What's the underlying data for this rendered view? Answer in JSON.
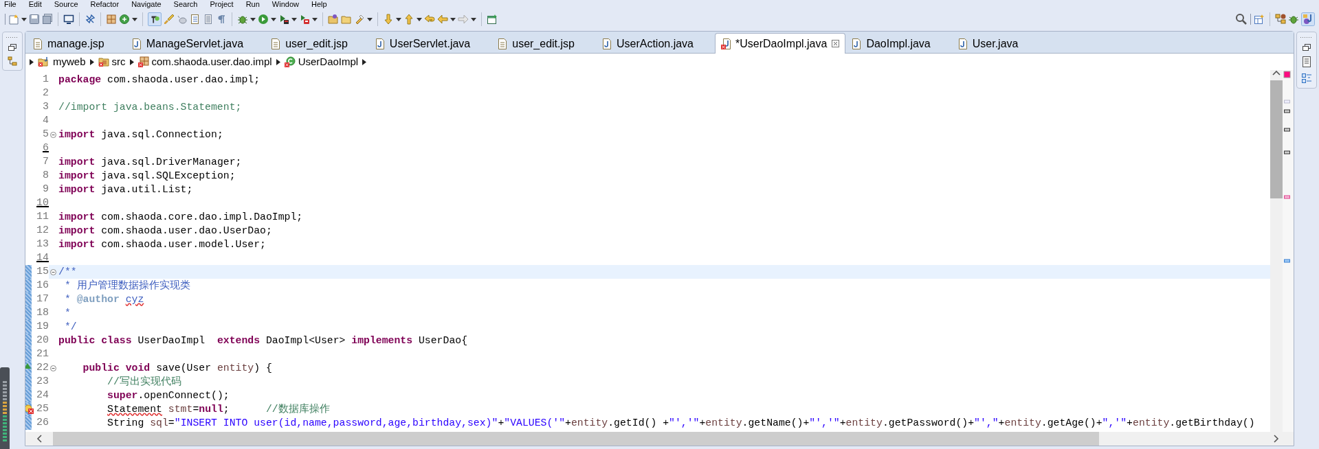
{
  "menu": [
    "File",
    "Edit",
    "Source",
    "Refactor",
    "Navigate",
    "Search",
    "Project",
    "Run",
    "Window",
    "Help"
  ],
  "tabs": [
    {
      "label": "manage.jsp",
      "kind": "jsp",
      "selected": false
    },
    {
      "label": "ManageServlet.java",
      "kind": "java",
      "selected": false
    },
    {
      "label": "user_edit.jsp",
      "kind": "jsp",
      "selected": false
    },
    {
      "label": "UserServlet.java",
      "kind": "java",
      "selected": false
    },
    {
      "label": "user_edit.jsp",
      "kind": "jsp",
      "selected": false
    },
    {
      "label": "UserAction.java",
      "kind": "java",
      "selected": false
    },
    {
      "label": "*UserDaoImpl.java",
      "kind": "java-error",
      "selected": true
    },
    {
      "label": "DaoImpl.java",
      "kind": "java",
      "selected": false
    },
    {
      "label": "User.java",
      "kind": "java",
      "selected": false
    }
  ],
  "breadcrumb": [
    {
      "label": "myweb",
      "kind": "project"
    },
    {
      "label": "src",
      "kind": "folder"
    },
    {
      "label": "com.shaoda.user.dao.impl",
      "kind": "package"
    },
    {
      "label": "UserDaoImpl",
      "kind": "class"
    }
  ],
  "editor": {
    "lines": [
      {
        "number": "1",
        "fold": false,
        "current": false,
        "changed": false,
        "deleted": false,
        "override_marker": false,
        "error_marker": false,
        "tokens": [
          {
            "kind": "keyword",
            "text": "package"
          },
          {
            "kind": "plain",
            "text": " com.shaoda.user.dao.impl;"
          }
        ]
      },
      {
        "number": "2",
        "fold": false,
        "current": false,
        "changed": false,
        "deleted": false,
        "override_marker": false,
        "error_marker": false
      },
      {
        "number": "3",
        "fold": false,
        "current": false,
        "changed": false,
        "deleted": false,
        "override_marker": false,
        "error_marker": false,
        "tokens": [
          {
            "kind": "comment",
            "text": "//import java.beans.Statement;"
          }
        ]
      },
      {
        "number": "4",
        "fold": false,
        "current": false,
        "changed": false,
        "deleted": false,
        "override_marker": false,
        "error_marker": false
      },
      {
        "number": "5",
        "fold": true,
        "current": false,
        "changed": false,
        "deleted": false,
        "override_marker": false,
        "error_marker": false,
        "tokens": [
          {
            "kind": "keyword",
            "text": "import"
          },
          {
            "kind": "plain",
            "text": " java.sql.Connection;"
          }
        ]
      },
      {
        "number": "6",
        "fold": false,
        "current": false,
        "changed": false,
        "deleted": true,
        "override_marker": false,
        "error_marker": false
      },
      {
        "number": "7",
        "fold": false,
        "current": false,
        "changed": false,
        "deleted": false,
        "override_marker": false,
        "error_marker": false,
        "tokens": [
          {
            "kind": "keyword",
            "text": "import"
          },
          {
            "kind": "plain",
            "text": " java.sql.DriverManager;"
          }
        ]
      },
      {
        "number": "8",
        "fold": false,
        "current": false,
        "changed": false,
        "deleted": false,
        "override_marker": false,
        "error_marker": false,
        "tokens": [
          {
            "kind": "keyword",
            "text": "import"
          },
          {
            "kind": "plain",
            "text": " java.sql.SQLException;"
          }
        ]
      },
      {
        "number": "9",
        "fold": false,
        "current": false,
        "changed": false,
        "deleted": false,
        "override_marker": false,
        "error_marker": false,
        "tokens": [
          {
            "kind": "keyword",
            "text": "import"
          },
          {
            "kind": "plain",
            "text": " java.util.List;"
          }
        ]
      },
      {
        "number": "10",
        "fold": false,
        "current": false,
        "changed": false,
        "deleted": true,
        "override_marker": false,
        "error_marker": false
      },
      {
        "number": "11",
        "fold": false,
        "current": false,
        "changed": false,
        "deleted": false,
        "override_marker": false,
        "error_marker": false,
        "tokens": [
          {
            "kind": "keyword",
            "text": "import"
          },
          {
            "kind": "plain",
            "text": " com.shaoda.core.dao.impl.DaoImpl;"
          }
        ]
      },
      {
        "number": "12",
        "fold": false,
        "current": false,
        "changed": false,
        "deleted": false,
        "override_marker": false,
        "error_marker": false,
        "tokens": [
          {
            "kind": "keyword",
            "text": "import"
          },
          {
            "kind": "plain",
            "text": " com.shaoda.user.dao.UserDao;"
          }
        ]
      },
      {
        "number": "13",
        "fold": false,
        "current": false,
        "changed": false,
        "deleted": false,
        "override_marker": false,
        "error_marker": false,
        "tokens": [
          {
            "kind": "keyword",
            "text": "import"
          },
          {
            "kind": "plain",
            "text": " com.shaoda.user.model.User;"
          }
        ]
      },
      {
        "number": "14",
        "fold": false,
        "current": false,
        "changed": false,
        "deleted": true,
        "override_marker": false,
        "error_marker": false
      },
      {
        "number": "15",
        "fold": true,
        "current": true,
        "changed": true,
        "deleted": false,
        "override_marker": false,
        "error_marker": false,
        "tokens": [
          {
            "kind": "javadoc",
            "text": "/**"
          }
        ]
      },
      {
        "number": "16",
        "fold": false,
        "current": false,
        "changed": true,
        "deleted": false,
        "override_marker": false,
        "error_marker": false,
        "tokens": [
          {
            "kind": "javadoc",
            "text": " * 用户管理数据操作实现类"
          }
        ]
      },
      {
        "number": "17",
        "fold": false,
        "current": false,
        "changed": true,
        "deleted": false,
        "override_marker": false,
        "error_marker": false,
        "tokens": [
          {
            "kind": "javadoc",
            "text": " * "
          },
          {
            "kind": "javadoc-tag",
            "text": "@author"
          },
          {
            "kind": "javadoc-misspelled",
            "text": " cyz"
          }
        ]
      },
      {
        "number": "18",
        "fold": false,
        "current": false,
        "changed": true,
        "deleted": false,
        "override_marker": false,
        "error_marker": false,
        "tokens": [
          {
            "kind": "javadoc",
            "text": " *"
          }
        ]
      },
      {
        "number": "19",
        "fold": false,
        "current": false,
        "changed": true,
        "deleted": false,
        "override_marker": false,
        "error_marker": false,
        "tokens": [
          {
            "kind": "javadoc",
            "text": " */"
          }
        ]
      },
      {
        "number": "20",
        "fold": false,
        "current": false,
        "changed": true,
        "deleted": false,
        "override_marker": false,
        "error_marker": false,
        "tokens": [
          {
            "kind": "keyword",
            "text": "public"
          },
          {
            "kind": "keyword",
            "text": " class"
          },
          {
            "kind": "plain",
            "text": " UserDaoImpl  "
          },
          {
            "kind": "keyword",
            "text": "extends"
          },
          {
            "kind": "plain",
            "text": " DaoImpl<User> "
          },
          {
            "kind": "keyword",
            "text": "implements"
          },
          {
            "kind": "plain",
            "text": " UserDao{"
          }
        ]
      },
      {
        "number": "21",
        "fold": false,
        "current": false,
        "changed": true,
        "deleted": false,
        "override_marker": false,
        "error_marker": false
      },
      {
        "number": "22",
        "fold": true,
        "current": false,
        "changed": true,
        "deleted": false,
        "override_marker": true,
        "error_marker": false,
        "tokens": [
          {
            "kind": "keyword",
            "text": "    public"
          },
          {
            "kind": "keyword",
            "text": " void"
          },
          {
            "kind": "plain",
            "text": " save(User "
          },
          {
            "kind": "variable",
            "text": "entity"
          },
          {
            "kind": "plain",
            "text": ") {"
          }
        ]
      },
      {
        "number": "23",
        "fold": false,
        "current": false,
        "changed": true,
        "deleted": false,
        "override_marker": false,
        "error_marker": false,
        "tokens": [
          {
            "kind": "comment",
            "text": "        //写出实现代码"
          }
        ]
      },
      {
        "number": "24",
        "fold": false,
        "current": false,
        "changed": true,
        "deleted": false,
        "override_marker": false,
        "error_marker": false,
        "tokens": [
          {
            "kind": "keyword",
            "text": "        super"
          },
          {
            "kind": "plain",
            "text": ".openConnect();"
          }
        ]
      },
      {
        "number": "25",
        "fold": false,
        "current": false,
        "changed": true,
        "deleted": false,
        "override_marker": false,
        "error_marker": true,
        "tokens": [
          {
            "kind": "error",
            "text": "        Statement"
          },
          {
            "kind": "variable",
            "text": " stmt"
          },
          {
            "kind": "plain",
            "text": "="
          },
          {
            "kind": "keyword",
            "text": "null"
          },
          {
            "kind": "plain",
            "text": ";"
          },
          {
            "kind": "comment",
            "text": "      //数据库操作"
          }
        ]
      },
      {
        "number": "26",
        "fold": false,
        "current": false,
        "changed": true,
        "deleted": false,
        "override_marker": false,
        "error_marker": false,
        "tokens": [
          {
            "kind": "plain",
            "text": "        String "
          },
          {
            "kind": "variable",
            "text": "sql"
          },
          {
            "kind": "plain",
            "text": "="
          },
          {
            "kind": "string",
            "text": "\"INSERT INTO user(id,name,password,age,birthday,sex)\""
          },
          {
            "kind": "plain",
            "text": "+"
          },
          {
            "kind": "string",
            "text": "\"VALUES('\""
          },
          {
            "kind": "plain",
            "text": "+"
          },
          {
            "kind": "variable",
            "text": "entity"
          },
          {
            "kind": "plain",
            "text": ".getId() +"
          },
          {
            "kind": "string",
            "text": "\"','\""
          },
          {
            "kind": "plain",
            "text": "+"
          },
          {
            "kind": "variable",
            "text": "entity"
          },
          {
            "kind": "plain",
            "text": ".getName()+"
          },
          {
            "kind": "string",
            "text": "\"','\""
          },
          {
            "kind": "plain",
            "text": "+"
          },
          {
            "kind": "variable",
            "text": "entity"
          },
          {
            "kind": "plain",
            "text": ".getPassword()+"
          },
          {
            "kind": "string",
            "text": "\"',\""
          },
          {
            "kind": "plain",
            "text": "+"
          },
          {
            "kind": "variable",
            "text": "entity"
          },
          {
            "kind": "plain",
            "text": ".getAge()+"
          },
          {
            "kind": "string",
            "text": "\",'\""
          },
          {
            "kind": "plain",
            "text": "+"
          },
          {
            "kind": "variable",
            "text": "entity"
          },
          {
            "kind": "plain",
            "text": ".getBirthday()"
          }
        ]
      }
    ]
  }
}
